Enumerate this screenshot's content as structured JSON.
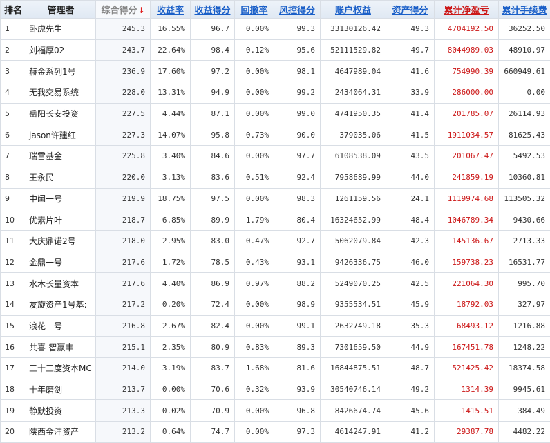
{
  "headers": {
    "rank": "排名",
    "manager": "管理者",
    "total_score": "综合得分",
    "total_score_arrow": "↓",
    "return_rate": "收益率",
    "return_score": "收益得分",
    "drawdown": "回撤率",
    "risk_score": "风控得分",
    "equity": "账户权益",
    "asset_score": "资产得分",
    "cum_pnl": "累计净盈亏",
    "cum_fee": "累计手续费"
  },
  "colors": {
    "header_link": "#1a5fc8",
    "profit_red": "#cc1818",
    "sort_arrow": "#e02020"
  },
  "rows": [
    {
      "rank": "1",
      "name": "卧虎先生",
      "score": "245.3",
      "ret": "16.55%",
      "ret_score": "96.7",
      "dd": "0.00%",
      "risk": "99.3",
      "equity": "33130126.42",
      "asset": "49.3",
      "pnl": "4704192.50",
      "fee": "36252.50"
    },
    {
      "rank": "2",
      "name": "刘福厚02",
      "score": "243.7",
      "ret": "22.64%",
      "ret_score": "98.4",
      "dd": "0.12%",
      "risk": "95.6",
      "equity": "52111529.82",
      "asset": "49.7",
      "pnl": "8044989.03",
      "fee": "48910.97"
    },
    {
      "rank": "3",
      "name": "赫金系列1号",
      "score": "236.9",
      "ret": "17.60%",
      "ret_score": "97.2",
      "dd": "0.00%",
      "risk": "98.1",
      "equity": "4647989.04",
      "asset": "41.6",
      "pnl": "754990.39",
      "fee": "660949.61"
    },
    {
      "rank": "4",
      "name": "无我交易系统",
      "score": "228.0",
      "ret": "13.31%",
      "ret_score": "94.9",
      "dd": "0.00%",
      "risk": "99.2",
      "equity": "2434064.31",
      "asset": "33.9",
      "pnl": "286000.00",
      "fee": "0.00"
    },
    {
      "rank": "5",
      "name": "岳阳长安投资",
      "score": "227.5",
      "ret": "4.44%",
      "ret_score": "87.1",
      "dd": "0.00%",
      "risk": "99.0",
      "equity": "4741950.35",
      "asset": "41.4",
      "pnl": "201785.07",
      "fee": "26114.93"
    },
    {
      "rank": "6",
      "name": "jason许建红",
      "score": "227.3",
      "ret": "14.07%",
      "ret_score": "95.8",
      "dd": "0.73%",
      "risk": "90.0",
      "equity": "379035.06",
      "asset": "41.5",
      "pnl": "1911034.57",
      "fee": "81625.43"
    },
    {
      "rank": "7",
      "name": "瑞雪基金",
      "score": "225.8",
      "ret": "3.40%",
      "ret_score": "84.6",
      "dd": "0.00%",
      "risk": "97.7",
      "equity": "6108538.09",
      "asset": "43.5",
      "pnl": "201067.47",
      "fee": "5492.53"
    },
    {
      "rank": "8",
      "name": "王永民",
      "score": "220.0",
      "ret": "3.13%",
      "ret_score": "83.6",
      "dd": "0.51%",
      "risk": "92.4",
      "equity": "7958689.99",
      "asset": "44.0",
      "pnl": "241859.19",
      "fee": "10360.81"
    },
    {
      "rank": "9",
      "name": "中闰一号",
      "score": "219.9",
      "ret": "18.75%",
      "ret_score": "97.5",
      "dd": "0.00%",
      "risk": "98.3",
      "equity": "1261159.56",
      "asset": "24.1",
      "pnl": "1119974.68",
      "fee": "113505.32"
    },
    {
      "rank": "10",
      "name": "优素片叶",
      "score": "218.7",
      "ret": "6.85%",
      "ret_score": "89.9",
      "dd": "1.79%",
      "risk": "80.4",
      "equity": "16324652.99",
      "asset": "48.4",
      "pnl": "1046789.34",
      "fee": "9430.66"
    },
    {
      "rank": "11",
      "name": "大庆鼎诺2号",
      "score": "218.0",
      "ret": "2.95%",
      "ret_score": "83.0",
      "dd": "0.47%",
      "risk": "92.7",
      "equity": "5062079.84",
      "asset": "42.3",
      "pnl": "145136.67",
      "fee": "2713.33"
    },
    {
      "rank": "12",
      "name": "金鼎一号",
      "score": "217.6",
      "ret": "1.72%",
      "ret_score": "78.5",
      "dd": "0.43%",
      "risk": "93.1",
      "equity": "9426336.75",
      "asset": "46.0",
      "pnl": "159738.23",
      "fee": "16531.77"
    },
    {
      "rank": "13",
      "name": "水木长量资本",
      "score": "217.6",
      "ret": "4.40%",
      "ret_score": "86.9",
      "dd": "0.97%",
      "risk": "88.2",
      "equity": "5249070.25",
      "asset": "42.5",
      "pnl": "221064.30",
      "fee": "995.70"
    },
    {
      "rank": "14",
      "name": "友旋资产1号基:",
      "score": "217.2",
      "ret": "0.20%",
      "ret_score": "72.4",
      "dd": "0.00%",
      "risk": "98.9",
      "equity": "9355534.51",
      "asset": "45.9",
      "pnl": "18792.03",
      "fee": "327.97"
    },
    {
      "rank": "15",
      "name": "浪花一号",
      "score": "216.8",
      "ret": "2.67%",
      "ret_score": "82.4",
      "dd": "0.00%",
      "risk": "99.1",
      "equity": "2632749.18",
      "asset": "35.3",
      "pnl": "68493.12",
      "fee": "1216.88"
    },
    {
      "rank": "16",
      "name": "共喜-智赢丰",
      "score": "215.1",
      "ret": "2.35%",
      "ret_score": "80.9",
      "dd": "0.83%",
      "risk": "89.3",
      "equity": "7301659.50",
      "asset": "44.9",
      "pnl": "167451.78",
      "fee": "1248.22"
    },
    {
      "rank": "17",
      "name": "三十三度资本MC",
      "score": "214.0",
      "ret": "3.19%",
      "ret_score": "83.7",
      "dd": "1.68%",
      "risk": "81.6",
      "equity": "16844875.51",
      "asset": "48.7",
      "pnl": "521425.42",
      "fee": "18374.58"
    },
    {
      "rank": "18",
      "name": "十年磨剑",
      "score": "213.7",
      "ret": "0.00%",
      "ret_score": "70.6",
      "dd": "0.32%",
      "risk": "93.9",
      "equity": "30540746.14",
      "asset": "49.2",
      "pnl": "1314.39",
      "fee": "9945.61"
    },
    {
      "rank": "19",
      "name": "静默投资",
      "score": "213.3",
      "ret": "0.02%",
      "ret_score": "70.9",
      "dd": "0.00%",
      "risk": "96.8",
      "equity": "8426674.74",
      "asset": "45.6",
      "pnl": "1415.51",
      "fee": "384.49"
    },
    {
      "rank": "20",
      "name": "陕西金沣资产",
      "score": "213.2",
      "ret": "0.64%",
      "ret_score": "74.7",
      "dd": "0.00%",
      "risk": "97.3",
      "equity": "4614247.91",
      "asset": "41.2",
      "pnl": "29387.78",
      "fee": "4482.22"
    }
  ]
}
